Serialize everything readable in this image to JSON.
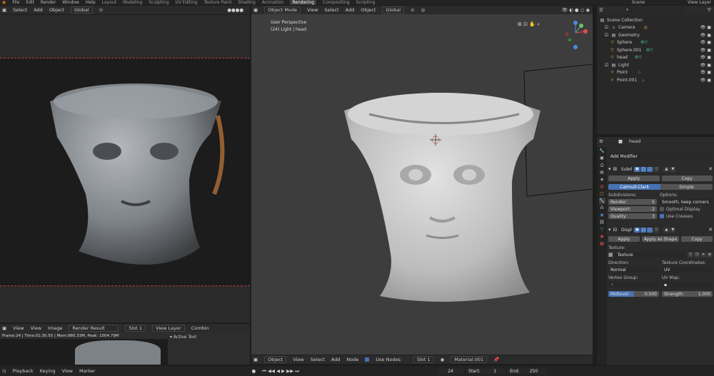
{
  "topbar": {
    "menus": [
      "File",
      "Edit",
      "Render",
      "Window",
      "Help"
    ],
    "workspaces": [
      "Layout",
      "Modeling",
      "Sculpting",
      "UV Editing",
      "Texture Paint",
      "Shading",
      "Animation",
      "Rendering",
      "Compositing",
      "Scripting"
    ],
    "active_workspace": "Rendering",
    "scene": "Scene",
    "view_layer": "View Layer"
  },
  "left_viewport": {
    "header": {
      "menus": [
        "Select",
        "Add",
        "Object"
      ],
      "transform": "Global"
    }
  },
  "main_viewport": {
    "mode": "Object Mode",
    "menus": [
      "View",
      "Select",
      "Add",
      "Object"
    ],
    "transform": "Global",
    "overlay_title": "User Perspective",
    "overlay_subtitle": "(24) Light | head"
  },
  "image_editor": {
    "menus": [
      "View",
      "View",
      "Image"
    ],
    "image": "Render Result",
    "slot": "Slot 1",
    "layer": "View Layer",
    "combined": "Combin",
    "status": "Frame:24 | Time:01:30.55 | Mem:980.33M, Peak: 1004.79M",
    "active_tool": "Active Tool"
  },
  "node_editor": {
    "type": "Object",
    "menus": [
      "View",
      "Select",
      "Add",
      "Node"
    ],
    "use_nodes": "Use Nodes",
    "slot": "Slot 1",
    "material": "Material.001"
  },
  "timeline": {
    "menus": [
      "Playback",
      "Keying",
      "View",
      "Marker"
    ],
    "current_frame": "24",
    "start_label": "Start:",
    "start": "1",
    "end_label": "End:",
    "end": "250"
  },
  "outliner": {
    "root": "Scene Collection",
    "items": [
      {
        "name": "Camera",
        "icon": "camera-icon",
        "depth": 1
      },
      {
        "name": "Geometry",
        "icon": "collection-icon",
        "depth": 1
      },
      {
        "name": "Sphere",
        "icon": "mesh-icon",
        "depth": 2
      },
      {
        "name": "Sphere.001",
        "icon": "mesh-icon",
        "depth": 2
      },
      {
        "name": "head",
        "icon": "mesh-icon",
        "depth": 2
      },
      {
        "name": "Light",
        "icon": "collection-icon",
        "depth": 1
      },
      {
        "name": "Point",
        "icon": "light-icon",
        "depth": 2
      },
      {
        "name": "Point.001",
        "icon": "light-icon",
        "depth": 2
      }
    ]
  },
  "properties": {
    "object_name": "head",
    "add_modifier": "Add Modifier",
    "subsurf": {
      "name": "Subd",
      "apply": "Apply",
      "copy": "Copy",
      "tab_active": "Catmull-Clark",
      "tab_other": "Simple",
      "subdivisions_label": "Subdivisions:",
      "options_label": "Options:",
      "render_label": "Render:",
      "render_value": "5",
      "viewport_label": "Viewport:",
      "viewport_value": "2",
      "quality_label": "Quality:",
      "quality_value": "3",
      "uv_smooth": "Smooth, keep corners",
      "optimal_display": "Optimal Display",
      "use_creases": "Use Creases"
    },
    "displace": {
      "name": "Displ",
      "apply": "Apply",
      "apply_shape": "Apply as Shape",
      "copy": "Copy",
      "texture_label": "Texture:",
      "texture": "Texture",
      "direction_label": "Direction:",
      "direction": "Normal",
      "coords_label": "Texture Coordinates:",
      "coords": "UV",
      "vgroup_label": "Vertex Group:",
      "uvmap_label": "UV Map:",
      "midlevel_label": "Midlevel:",
      "midlevel": "0.500",
      "strength_label": "Strength:",
      "strength": "1.000"
    }
  }
}
